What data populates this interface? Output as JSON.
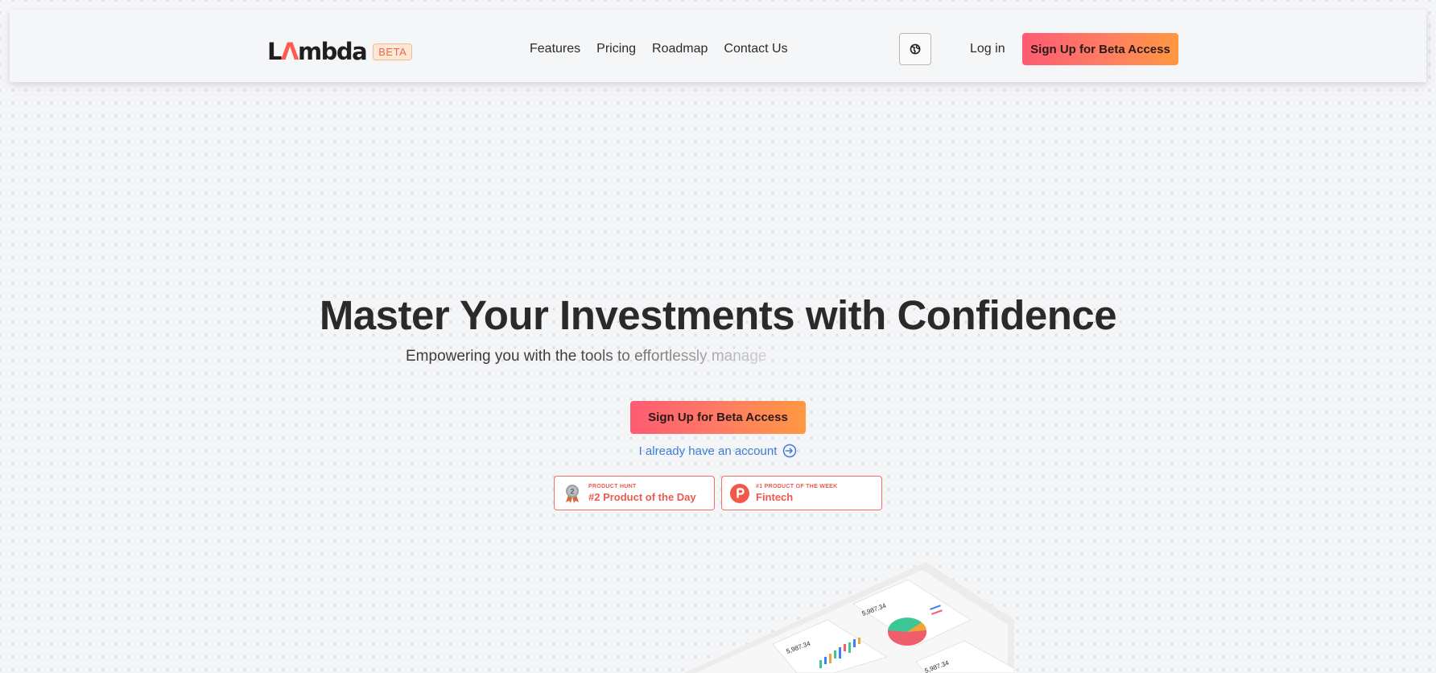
{
  "nav": {
    "logo_text": "LΛmbda",
    "beta_label": "BETA",
    "links": [
      "Features",
      "Pricing",
      "Roadmap",
      "Contact Us"
    ],
    "globe_icon": "globe-icon",
    "login_label": "Log in",
    "cta_label": "Sign Up for Beta Access"
  },
  "hero": {
    "title": "Master Your Investments with Confidence",
    "subtitle": "Empowering you with the tools to effortlessly manage",
    "cta_label": "Sign Up for Beta Access",
    "account_link": "I already have an account",
    "account_icon": "arrow-right-circle-icon"
  },
  "badges": [
    {
      "label": "PRODUCT HUNT",
      "title": "#2 Product of the Day",
      "icon": "medal-icon"
    },
    {
      "label": "#1 PRODUCT OF THE WEEK",
      "title": "Fintech",
      "icon": "product-hunt-icon"
    }
  ],
  "preview": {
    "amount": "5,987.34"
  },
  "colors": {
    "accent_start": "#fe5b73",
    "accent_end": "#ff9841",
    "link": "#3d7dd8",
    "badge": "#ec5a4f"
  }
}
